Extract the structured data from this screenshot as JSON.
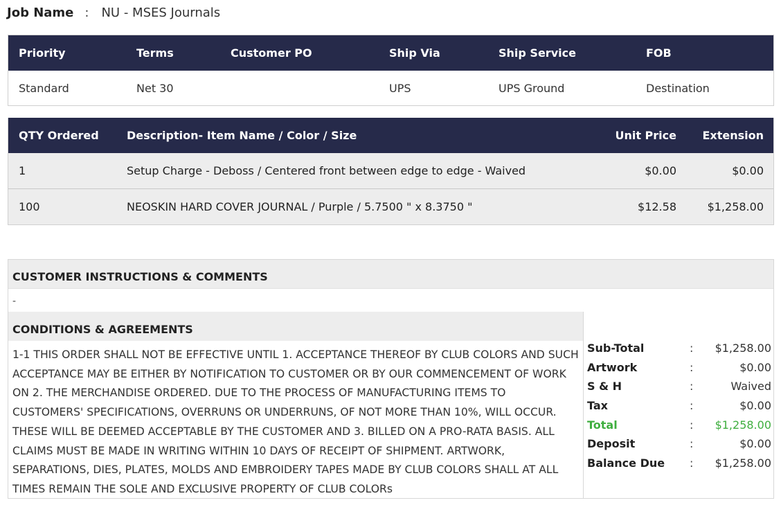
{
  "job": {
    "label": "Job Name",
    "separator": ":",
    "value": "NU - MSES Journals"
  },
  "shipping": {
    "headers": [
      "Priority",
      "Terms",
      "Customer PO",
      "Ship Via",
      "Ship Service",
      "FOB"
    ],
    "values": [
      "Standard",
      "Net 30",
      "",
      "UPS",
      "UPS Ground",
      "Destination"
    ]
  },
  "items": {
    "headers": [
      "QTY Ordered",
      "Description- Item Name / Color / Size",
      "Unit Price",
      "Extension"
    ],
    "rows": [
      {
        "qty": "1",
        "description": "Setup Charge - Deboss / Centered front between edge to edge - Waived",
        "unit_price": "$0.00",
        "extension": "$0.00"
      },
      {
        "qty": "100",
        "description": "NEOSKIN HARD COVER JOURNAL / Purple / 5.7500 \" x 8.3750 \"",
        "unit_price": "$12.58",
        "extension": "$1,258.00"
      }
    ]
  },
  "customer_instructions": {
    "title": "CUSTOMER INSTRUCTIONS & COMMENTS",
    "text": "-"
  },
  "conditions": {
    "title": "CONDITIONS & AGREEMENTS",
    "lines": [
      "1-1 THIS ORDER SHALL NOT BE EFFECTIVE UNTIL 1. ACCEPTANCE THEREOF BY CLUB COLORS AND SUCH",
      "ACCEPTANCE MAY BE EITHER BY NOTIFICATION TO CUSTOMER OR BY OUR COMMENCEMENT OF WORK",
      "ON 2. THE MERCHANDISE ORDERED. DUE TO THE PROCESS OF MANUFACTURING ITEMS TO",
      "CUSTOMERS' SPECIFICATIONS, OVERRUNS OR UNDERRUNS, OF NOT MORE THAN 10%, WILL OCCUR.",
      "THESE WILL BE DEEMED ACCEPTABLE BY THE CUSTOMER AND 3. BILLED ON A PRO-RATA BASIS. ALL",
      "CLAIMS MUST BE MADE IN WRITING WITHIN 10 DAYS OF RECEIPT OF SHIPMENT. ARTWORK,",
      "SEPARATIONS, DIES, PLATES, MOLDS AND EMBROIDERY TAPES MADE BY CLUB COLORS SHALL AT ALL",
      "TIMES REMAIN THE SOLE AND EXCLUSIVE PROPERTY OF CLUB COLORs"
    ]
  },
  "totals": [
    {
      "label": "Sub-Total",
      "sep": ":",
      "value": "$1,258.00"
    },
    {
      "label": "Artwork",
      "sep": ":",
      "value": "$0.00"
    },
    {
      "label": "S & H",
      "sep": ":",
      "value": "Waived"
    },
    {
      "label": "Tax",
      "sep": ":",
      "value": "$0.00"
    },
    {
      "label": "Total",
      "sep": ":",
      "value": "$1,258.00"
    },
    {
      "label": "Deposit",
      "sep": ":",
      "value": "$0.00"
    },
    {
      "label": "Balance Due",
      "sep": ":",
      "value": "$1,258.00"
    }
  ],
  "colors": {
    "header_bg": "#262a4a",
    "total_green": "#3fae3f",
    "row_bg": "#ededed"
  }
}
